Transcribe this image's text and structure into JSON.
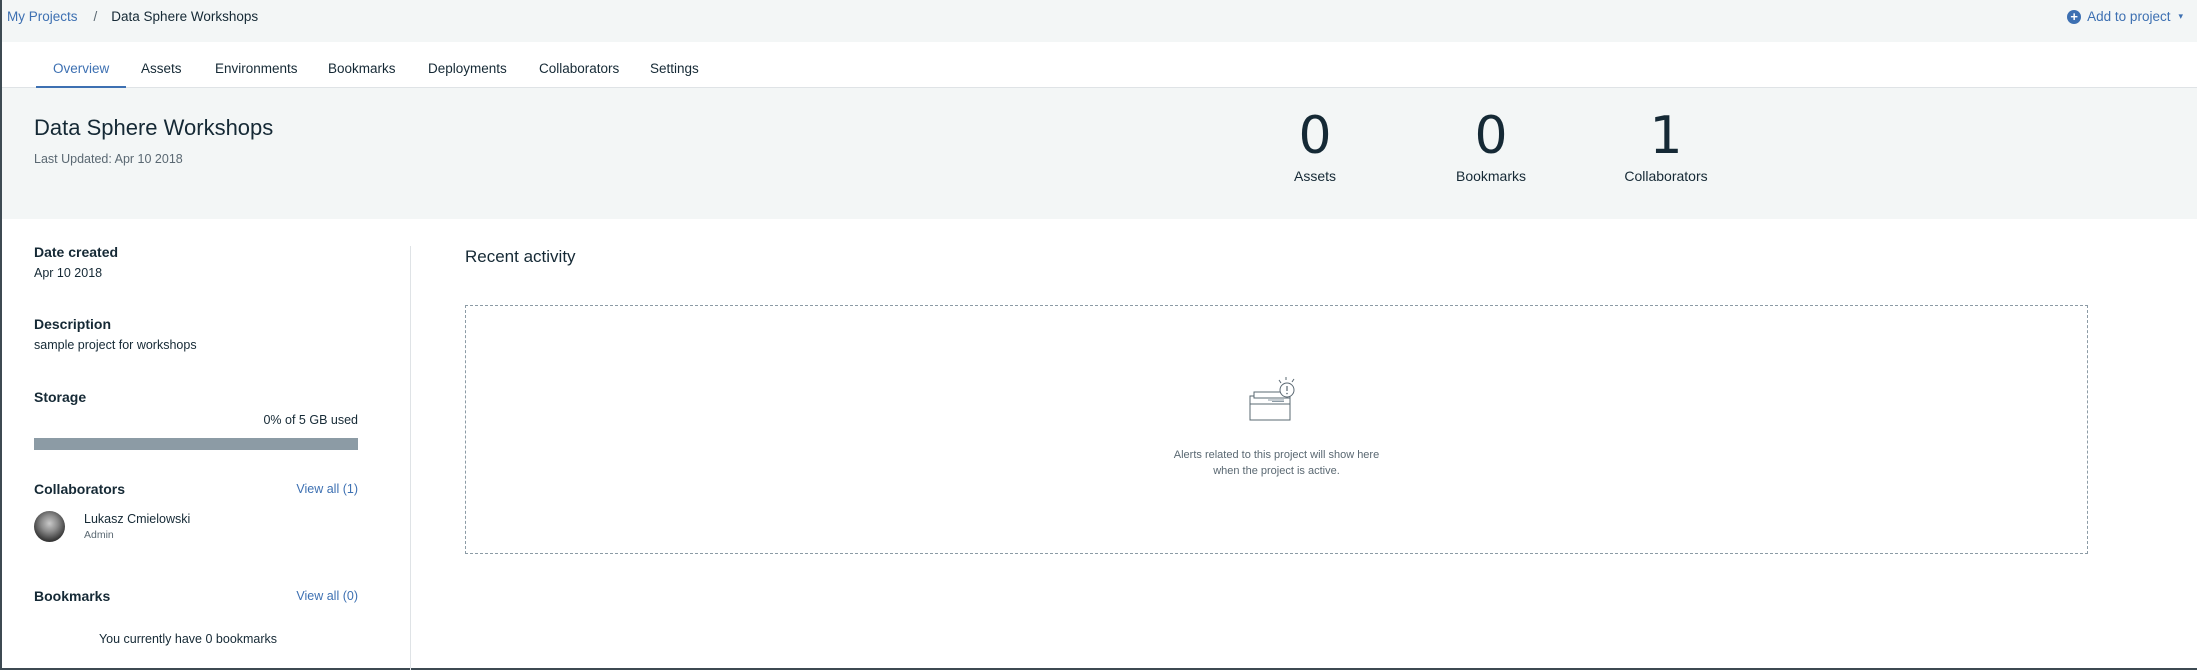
{
  "breadcrumb": {
    "root": "My Projects",
    "separator": "/",
    "current": "Data Sphere Workshops"
  },
  "add_to_project": {
    "label": "Add to project",
    "caret": "▾"
  },
  "tabs": [
    {
      "label": "Overview",
      "active": true
    },
    {
      "label": "Assets"
    },
    {
      "label": "Environments"
    },
    {
      "label": "Bookmarks"
    },
    {
      "label": "Deployments"
    },
    {
      "label": "Collaborators"
    },
    {
      "label": "Settings"
    }
  ],
  "project": {
    "title": "Data Sphere Workshops",
    "last_updated": "Last Updated: Apr 10 2018"
  },
  "stats": [
    {
      "value": "0",
      "label": "Assets"
    },
    {
      "value": "0",
      "label": "Bookmarks"
    },
    {
      "value": "1",
      "label": "Collaborators"
    }
  ],
  "sidebar": {
    "date_created": {
      "title": "Date created",
      "value": "Apr 10 2018"
    },
    "description": {
      "title": "Description",
      "value": "sample project for workshops"
    },
    "storage": {
      "title": "Storage",
      "used_text": "0% of 5 GB used",
      "used_fraction": 0
    },
    "collaborators": {
      "title": "Collaborators",
      "view_all": "View all (1)",
      "items": [
        {
          "name": "Lukasz Cmielowski",
          "role": "Admin"
        }
      ]
    },
    "bookmarks": {
      "title": "Bookmarks",
      "view_all": "View all (0)",
      "empty_text": "You currently have 0 bookmarks"
    }
  },
  "activity": {
    "title": "Recent activity",
    "empty_line1": "Alerts related to this project will show here",
    "empty_line2": "when the project is active.",
    "icon": "activity-alert-icon"
  },
  "colors": {
    "link": "#3d70b2",
    "text": "#152935",
    "muted": "#5a6872",
    "hero_bg": "#f3f6f6",
    "storage_bar": "#8c9ba5"
  }
}
